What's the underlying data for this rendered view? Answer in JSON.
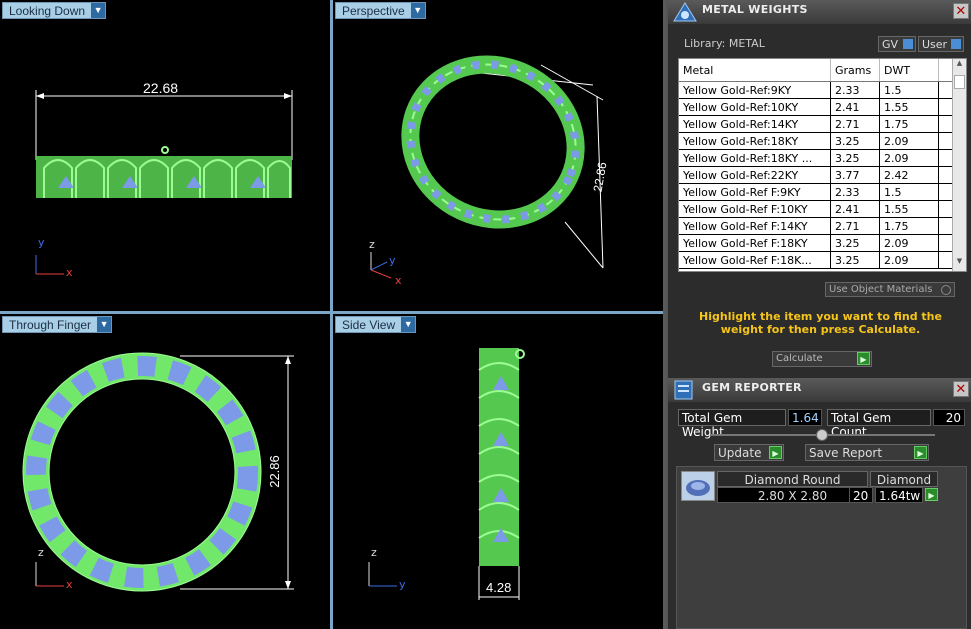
{
  "viewports": [
    {
      "label": "Looking Down",
      "dim": "22.68",
      "axes": [
        "y",
        "x"
      ]
    },
    {
      "label": "Perspective",
      "dim": "22.86",
      "axes": [
        "z",
        "y",
        "x"
      ]
    },
    {
      "label": "Through Finger",
      "dim": "22.86",
      "axes": [
        "z",
        "x"
      ]
    },
    {
      "label": "Side View",
      "dim": "4.28",
      "axes": [
        "z",
        "y"
      ]
    }
  ],
  "metal": {
    "title": "METAL WEIGHTS",
    "library": "Library: METAL",
    "gv": "GV",
    "user": "User",
    "cols": [
      "Metal",
      "Grams",
      "DWT"
    ],
    "rows": [
      [
        "Yellow Gold-Ref:9KY",
        "2.33",
        "1.5"
      ],
      [
        "Yellow Gold-Ref:10KY",
        "2.41",
        "1.55"
      ],
      [
        "Yellow Gold-Ref:14KY",
        "2.71",
        "1.75"
      ],
      [
        "Yellow Gold-Ref:18KY",
        "3.25",
        "2.09"
      ],
      [
        "Yellow Gold-Ref:18KY ...",
        "3.25",
        "2.09"
      ],
      [
        "Yellow Gold-Ref:22KY",
        "3.77",
        "2.42"
      ],
      [
        "Yellow Gold-Ref F:9KY",
        "2.33",
        "1.5"
      ],
      [
        "Yellow Gold-Ref F:10KY",
        "2.41",
        "1.55"
      ],
      [
        "Yellow Gold-Ref F:14KY",
        "2.71",
        "1.75"
      ],
      [
        "Yellow Gold-Ref F:18KY",
        "3.25",
        "2.09"
      ],
      [
        "Yellow Gold-Ref F:18K...",
        "3.25",
        "2.09"
      ]
    ],
    "use_obj": "Use Object Materials",
    "hint": "Highlight the item you want to find the weight for then press Calculate.",
    "calc": "Calculate"
  },
  "gem": {
    "title": "GEM REPORTER",
    "total_weight_label": "Total Gem Weight",
    "total_weight": "1.64",
    "total_count_label": "Total Gem Count",
    "total_count": "20",
    "update": "Update",
    "save": "Save Report",
    "shape": "Diamond Round",
    "material": "Diamond",
    "size": "2.80 X 2.80",
    "count": "20",
    "carat": "1.64tw"
  },
  "colors": {
    "wire": "#72e86a",
    "gem": "#7d9ae8",
    "accent": "#f6c51a"
  }
}
